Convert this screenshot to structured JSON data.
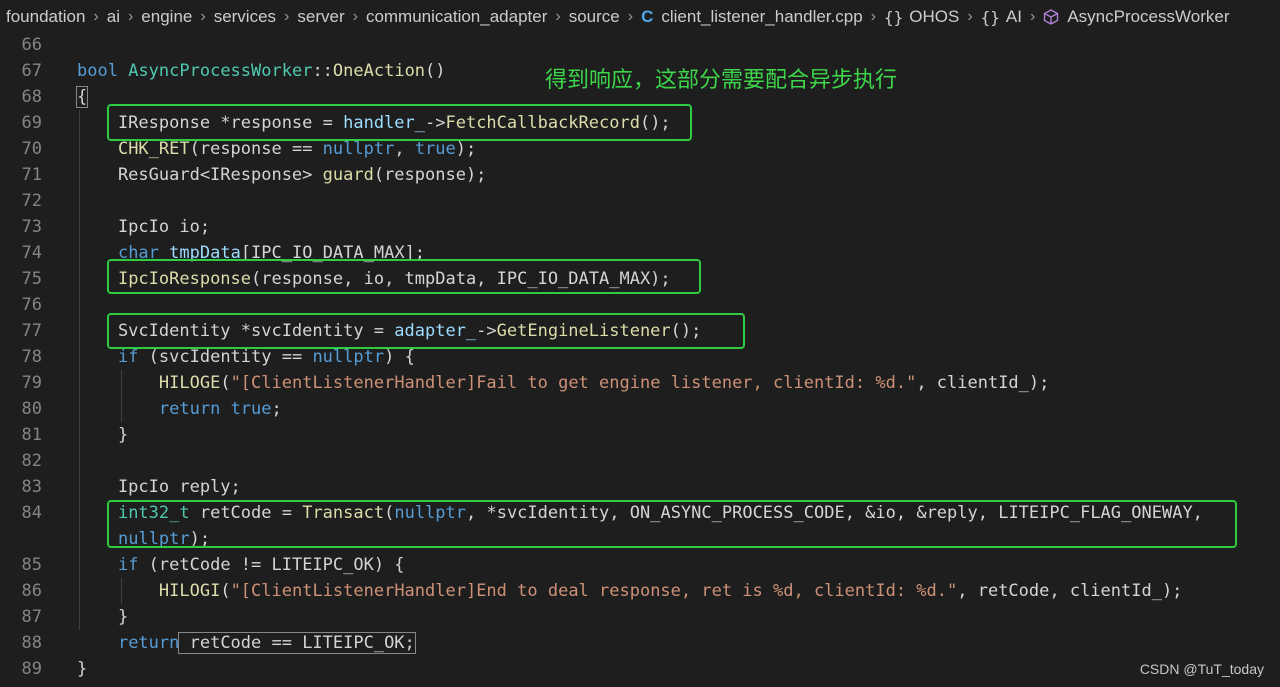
{
  "breadcrumb": {
    "items": [
      "foundation",
      "ai",
      "engine",
      "services",
      "server",
      "communication_adapter",
      "source"
    ],
    "file": "client_listener_handler.cpp",
    "namespaces": [
      "OHOS",
      "AI"
    ],
    "symbol": "AsyncProcessWorker",
    "separator": "›",
    "ns_glyph": "{}",
    "file_glyph": "C"
  },
  "annotation": "得到响应，这部分需要配合异步执行",
  "watermark": "CSDN @TuT_today",
  "colors": {
    "highlight_box": "#2ecc40",
    "annotation": "#3dd64a"
  },
  "lines": [
    {
      "n": "66",
      "tokens": []
    },
    {
      "n": "67",
      "tokens": [
        [
          "k",
          "bool"
        ],
        [
          "p",
          " "
        ],
        [
          "t",
          "AsyncProcessWorker"
        ],
        [
          "p",
          "::"
        ],
        [
          "f",
          "OneAction"
        ],
        [
          "p",
          "()"
        ]
      ]
    },
    {
      "n": "68",
      "tokens": [
        [
          "p",
          "{"
        ]
      ]
    },
    {
      "n": "69",
      "tokens": [
        [
          "p",
          "    IResponse *response = "
        ],
        [
          "v",
          "handler_"
        ],
        [
          "p",
          "->"
        ],
        [
          "f",
          "FetchCallbackRecord"
        ],
        [
          "p",
          "();"
        ]
      ]
    },
    {
      "n": "70",
      "tokens": [
        [
          "p",
          "    "
        ],
        [
          "f",
          "CHK_RET"
        ],
        [
          "p",
          "(response == "
        ],
        [
          "k",
          "nullptr"
        ],
        [
          "p",
          ", "
        ],
        [
          "k",
          "true"
        ],
        [
          "p",
          ");"
        ]
      ]
    },
    {
      "n": "71",
      "tokens": [
        [
          "p",
          "    ResGuard<IResponse> "
        ],
        [
          "f",
          "guard"
        ],
        [
          "p",
          "(response);"
        ]
      ]
    },
    {
      "n": "72",
      "tokens": []
    },
    {
      "n": "73",
      "tokens": [
        [
          "p",
          "    IpcIo io;"
        ]
      ]
    },
    {
      "n": "74",
      "tokens": [
        [
          "p",
          "    "
        ],
        [
          "k",
          "char"
        ],
        [
          "p",
          " "
        ],
        [
          "v",
          "tmpData"
        ],
        [
          "p",
          "[IPC_IO_DATA_MAX];"
        ]
      ]
    },
    {
      "n": "75",
      "tokens": [
        [
          "p",
          "    "
        ],
        [
          "f",
          "IpcIoResponse"
        ],
        [
          "p",
          "(response, io, tmpData, IPC_IO_DATA_MAX);"
        ]
      ]
    },
    {
      "n": "76",
      "tokens": []
    },
    {
      "n": "77",
      "tokens": [
        [
          "p",
          "    SvcIdentity *svcIdentity = "
        ],
        [
          "v",
          "adapter_"
        ],
        [
          "p",
          "->"
        ],
        [
          "f",
          "GetEngineListener"
        ],
        [
          "p",
          "();"
        ]
      ]
    },
    {
      "n": "78",
      "tokens": [
        [
          "p",
          "    "
        ],
        [
          "k",
          "if"
        ],
        [
          "p",
          " (svcIdentity == "
        ],
        [
          "k",
          "nullptr"
        ],
        [
          "p",
          ") {"
        ]
      ]
    },
    {
      "n": "79",
      "tokens": [
        [
          "p",
          "        "
        ],
        [
          "f",
          "HILOGE"
        ],
        [
          "p",
          "("
        ],
        [
          "s",
          "\"[ClientListenerHandler]Fail to get engine listener, clientId: %d.\""
        ],
        [
          "p",
          ", clientId_);"
        ]
      ]
    },
    {
      "n": "80",
      "tokens": [
        [
          "p",
          "        "
        ],
        [
          "k",
          "return"
        ],
        [
          "p",
          " "
        ],
        [
          "k",
          "true"
        ],
        [
          "p",
          ";"
        ]
      ]
    },
    {
      "n": "81",
      "tokens": [
        [
          "p",
          "    }"
        ]
      ]
    },
    {
      "n": "82",
      "tokens": []
    },
    {
      "n": "83",
      "tokens": [
        [
          "p",
          "    IpcIo reply;"
        ]
      ]
    },
    {
      "n": "84",
      "tokens": [
        [
          "p",
          "    "
        ],
        [
          "t",
          "int32_t"
        ],
        [
          "p",
          " retCode = "
        ],
        [
          "f",
          "Transact"
        ],
        [
          "p",
          "("
        ],
        [
          "k",
          "nullptr"
        ],
        [
          "p",
          ", *svcIdentity, ON_ASYNC_PROCESS_CODE, &io, &reply, LITEIPC_FLAG_ONEWAY,"
        ]
      ]
    },
    {
      "n": "",
      "tokens": [
        [
          "p",
          "    "
        ],
        [
          "k",
          "nullptr"
        ],
        [
          "p",
          ");"
        ]
      ]
    },
    {
      "n": "85",
      "tokens": [
        [
          "p",
          "    "
        ],
        [
          "k",
          "if"
        ],
        [
          "p",
          " (retCode != LITEIPC_OK) {"
        ]
      ]
    },
    {
      "n": "86",
      "tokens": [
        [
          "p",
          "        "
        ],
        [
          "f",
          "HILOGI"
        ],
        [
          "p",
          "("
        ],
        [
          "s",
          "\"[ClientListenerHandler]End to deal response, ret is %d, clientId: %d.\""
        ],
        [
          "p",
          ", retCode, clientId_);"
        ]
      ]
    },
    {
      "n": "87",
      "tokens": [
        [
          "p",
          "    }"
        ]
      ]
    },
    {
      "n": "88",
      "tokens": [
        [
          "p",
          "    "
        ],
        [
          "k",
          "return"
        ],
        [
          "p",
          " retCode == LITEIPC_OK;"
        ]
      ]
    },
    {
      "n": "89",
      "tokens": [
        [
          "p",
          "}"
        ]
      ]
    }
  ]
}
